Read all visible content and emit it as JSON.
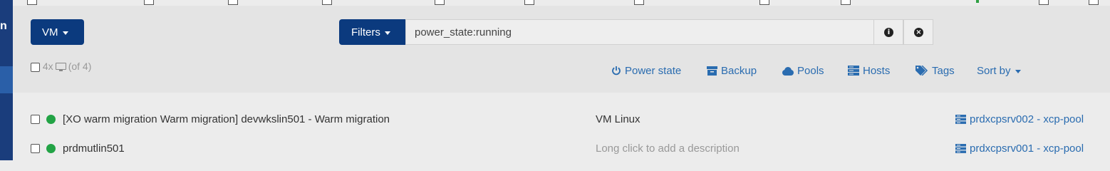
{
  "colors": {
    "accent": "#0b3a7e",
    "link": "#2a6cb0",
    "running": "#22a345",
    "sidebar": "#1a3d7c"
  },
  "sidebar": {
    "partial_glyph": "n"
  },
  "type_dropdown": {
    "label": "VM",
    "icon": "caret-down-icon"
  },
  "filters": {
    "label": "Filters",
    "icon": "caret-down-icon"
  },
  "search": {
    "value": "power_state:running",
    "placeholder": ""
  },
  "actions": {
    "info_icon": "info-circle-icon",
    "clear_icon": "times-circle-icon"
  },
  "selection": {
    "count": "4x",
    "total": "(of 4)",
    "icon": "monitor-icon"
  },
  "toolbar": {
    "power_state": "Power state",
    "backup": "Backup",
    "pools": "Pools",
    "hosts": "Hosts",
    "tags": "Tags",
    "sort_by": "Sort by"
  },
  "vms": [
    {
      "name": "[XO warm migration Warm migration] devwkslin501 - Warm migration",
      "description": "VM Linux",
      "host": "prdxcpsrv002 - xcp-pool",
      "state": "running"
    },
    {
      "name": "prdmutlin501",
      "description": "Long click to add a description",
      "host": "prdxcpsrv001 - xcp-pool",
      "state": "running"
    }
  ]
}
